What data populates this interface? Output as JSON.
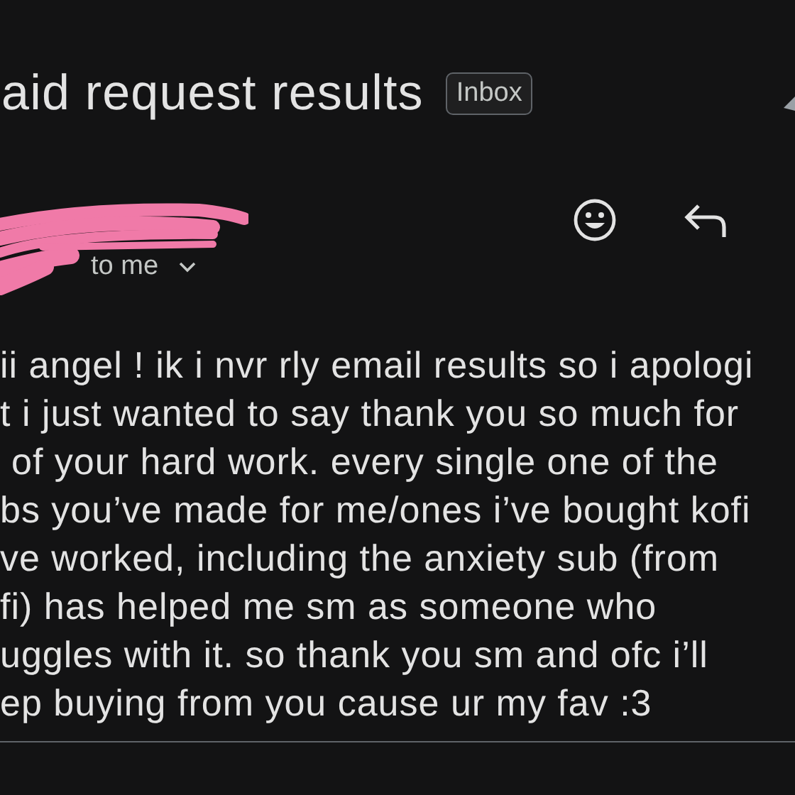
{
  "subject": {
    "title": "aid request results",
    "label": "Inbox"
  },
  "message": {
    "recipient": "to me"
  },
  "body": {
    "lines": [
      "ii angel ! ik i nvr rly email results so i apologi",
      "t i just wanted to say thank you so much for",
      "of your hard work. every single one of the",
      "bs you’ve made for me/ones i’ve bought kofi",
      "ve worked, including the anxiety sub (from",
      "fi) has helped me sm as someone who",
      "uggles with it. so thank you sm and ofc i’ll",
      "ep buying from you cause ur my fav :3"
    ]
  }
}
